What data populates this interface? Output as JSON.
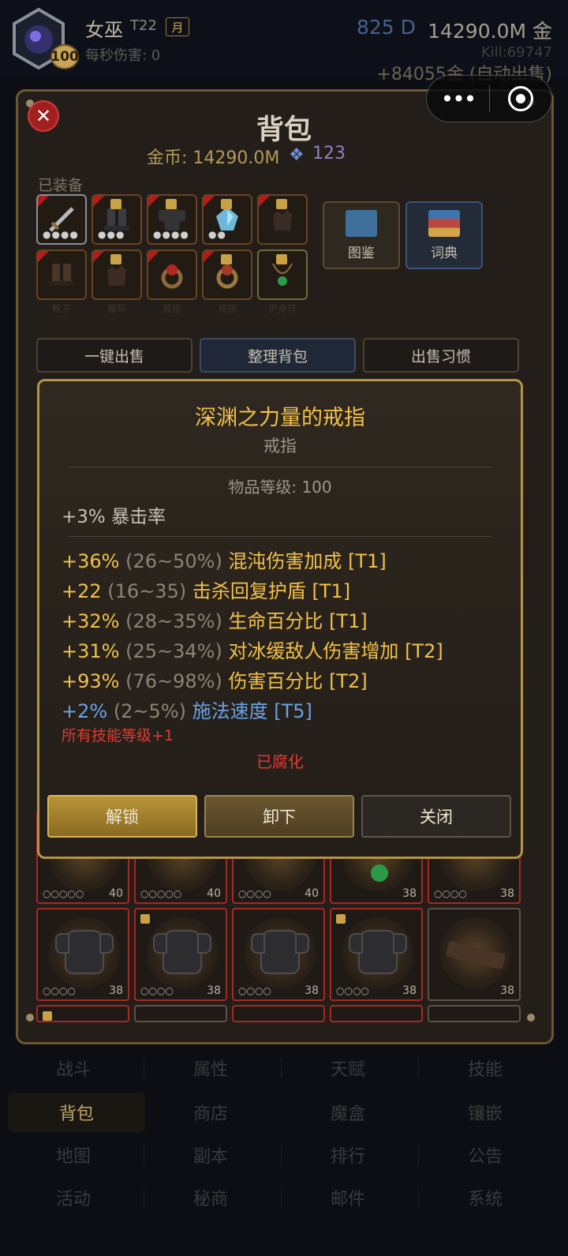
{
  "header": {
    "name": "女巫",
    "tier": "T22",
    "month_badge": "月",
    "dps": "每秒伤害: 0",
    "level": "100",
    "diamonds": "825 D",
    "gold": "14290.0M 金",
    "kills": "Kill:69747",
    "auto_sell": "+84055金 (自动出售)"
  },
  "capsule": {
    "more": "•••"
  },
  "panel": {
    "title": "背包",
    "gold_line": "金币: 14290.0M",
    "gem_icon": "gem-icon",
    "gems": "123",
    "equipped_label": "已装备"
  },
  "equipped": [
    {
      "icon": "sword-icon",
      "dots": "●●●●"
    },
    {
      "icon": "boots-icon",
      "dots": "●●●"
    },
    {
      "icon": "chest-armor-icon",
      "dots": "●●●●"
    },
    {
      "icon": "crystal-icon",
      "dots": "●●"
    },
    {
      "icon": "gloves-icon",
      "dots": ""
    },
    {
      "icon": "boots-icon",
      "label": "靴子"
    },
    {
      "icon": "gloves-icon",
      "label": "腰带"
    },
    {
      "icon": "ring-icon",
      "label": "戒指"
    },
    {
      "icon": "ring-icon",
      "label": "戒指"
    },
    {
      "icon": "amulet-icon",
      "label": "护身符"
    }
  ],
  "side_buttons": {
    "atlas": "图鉴",
    "dictionary": "词典"
  },
  "actions": {
    "quick_sell": "一键出售",
    "sort": "整理背包",
    "sell_habit": "出售习惯"
  },
  "tooltip": {
    "name": "深渊之力量的戒指",
    "type": "戒指",
    "item_level": "物品等级: 100",
    "implicit": "+3% 暴击率",
    "affixes": [
      {
        "value": "+36%",
        "range": " (26~50%) ",
        "text": "混沌伤害加成 [T1]",
        "color": "gold"
      },
      {
        "value": "+22",
        "range": " (16~35) ",
        "text": "击杀回复护盾 [T1]",
        "color": "gold"
      },
      {
        "value": "+32%",
        "range": " (28~35%) ",
        "text": "生命百分比 [T1]",
        "color": "gold"
      },
      {
        "value": "+31%",
        "range": " (25~34%) ",
        "text": "对冰缓敌人伤害增加 [T2]",
        "color": "gold"
      },
      {
        "value": "+93%",
        "range": " (76~98%) ",
        "text": "伤害百分比 [T2]",
        "color": "gold"
      },
      {
        "value": "+2%",
        "range": " (2~5%) ",
        "text": "施法速度 [T5]",
        "color": "blue"
      }
    ],
    "skill_bonus": "所有技能等级+1",
    "corrupted": "已腐化",
    "btn_unlock": "解锁",
    "btn_unequip": "卸下",
    "btn_close": "关闭"
  },
  "bag_row1": [
    {
      "icon": "crossed-swords-icon",
      "dots": "○○○○○",
      "level": "40"
    },
    {
      "icon": "staff-icon",
      "dots": "○○○○○",
      "level": "40"
    },
    {
      "icon": "crossed-swords-icon",
      "dots": "○○○○",
      "level": "40"
    },
    {
      "icon": "emerald-amulet-icon",
      "dots": "",
      "level": "38"
    },
    {
      "icon": "chest-armor-icon",
      "dots": "○○○○",
      "level": "38"
    }
  ],
  "bag_row2": [
    {
      "icon": "chest-armor-icon",
      "dots": "○○○○",
      "level": "38"
    },
    {
      "icon": "chest-armor-icon",
      "dots": "○○○○",
      "level": "38"
    },
    {
      "icon": "chest-armor-icon",
      "dots": "○○○○",
      "level": "38"
    },
    {
      "icon": "chest-armor-icon",
      "dots": "○○○○",
      "level": "38"
    },
    {
      "icon": "belt-icon",
      "dots": "",
      "level": "38"
    }
  ],
  "nav": [
    "战斗",
    "属性",
    "天赋",
    "技能",
    "背包",
    "商店",
    "魔盒",
    "镶嵌",
    "地图",
    "副本",
    "排行",
    "公告",
    "活动",
    "秘商",
    "邮件",
    "系统"
  ]
}
